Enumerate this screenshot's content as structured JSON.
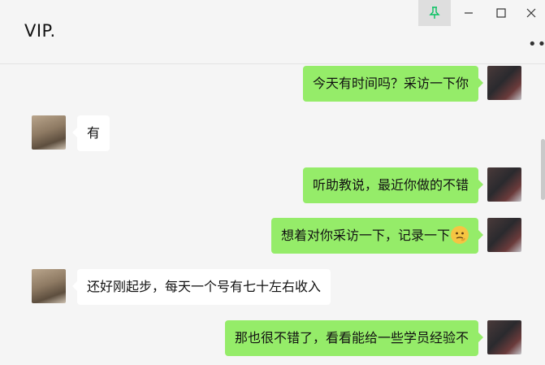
{
  "header": {
    "title": "VIP.",
    "pin_icon": "pin-icon",
    "minimize_icon": "minimize-icon",
    "maximize_icon": "maximize-icon",
    "close_icon": "close-icon",
    "more_icon": "more-icon"
  },
  "colors": {
    "outgoing": "#95ec69",
    "incoming": "#ffffff",
    "background": "#f5f5f5",
    "pin_active": "#07c160"
  },
  "messages": [
    {
      "from": "me",
      "text": "今天有时间吗？采访一下你"
    },
    {
      "from": "other",
      "text": "有"
    },
    {
      "from": "me",
      "text": "听助教说，最近你做的不错"
    },
    {
      "from": "me",
      "text": "想着对你采访一下，记录一下",
      "emoji": "thinking-face-emoji"
    },
    {
      "from": "other",
      "text": "还好刚起步，每天一个号有七十左右收入"
    },
    {
      "from": "me",
      "text": "那也很不错了，看看能给一些学员经验不"
    }
  ]
}
